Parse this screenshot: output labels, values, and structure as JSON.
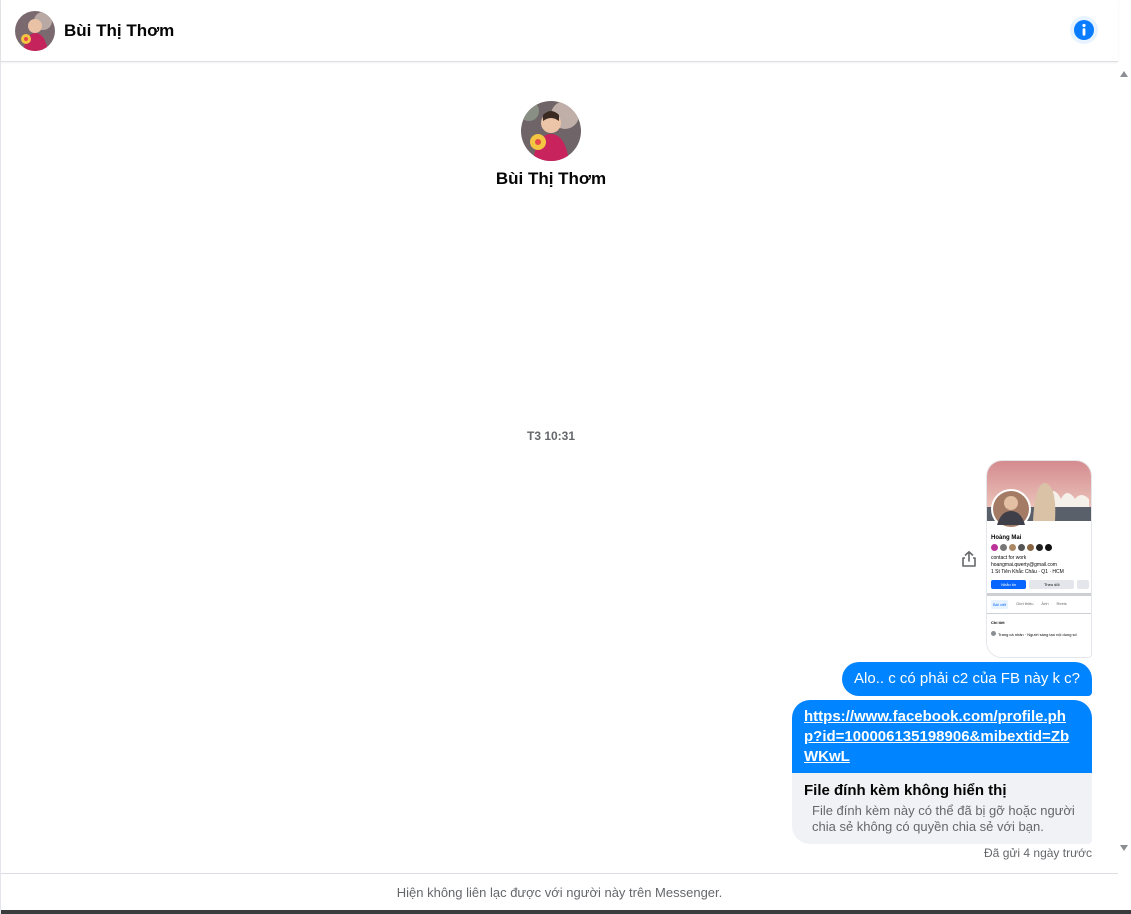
{
  "header": {
    "contact_name": "Bùi Thị Thơm",
    "info_icon": "info-icon"
  },
  "profile": {
    "name": "Bùi Thị Thơm"
  },
  "thread": {
    "timestamp": "T3 10:31",
    "shared_image": {
      "profile_name": "Hoàng Mai",
      "profile_line1": "contact for work",
      "profile_line2": "hoangmai.qwerty@gmail.com",
      "profile_line3": "1 St Tiên Khắc Châu · Q1 · HCM",
      "button_primary": "Nhắn tin",
      "button_secondary": "Theo dõi",
      "tabs": [
        "Bài viết",
        "Giới thiệu",
        "Ảnh",
        "Reels"
      ],
      "section": "Chi tiết",
      "detail": "Trang cá nhân · Người sáng tạo nội dung số"
    },
    "messages": [
      {
        "text": "Alo.. c có phải c2 của FB này k c?"
      },
      {
        "link": "https://www.facebook.com/profile.php?id=100006135198906&mibextid=ZbWKwL"
      }
    ],
    "attachment": {
      "title": "File đính kèm không hiển thị",
      "description": "File đính kèm này có thể đã bị gỡ hoặc người chia sẻ không có quyền chia sẻ với bạn."
    },
    "sent_status": "Đã gửi 4 ngày trước"
  },
  "footer": {
    "notice": "Hiện không liên lạc được với người này trên Messenger."
  },
  "colors": {
    "accent": "#0084ff",
    "bubble_gray": "#f0f2f5",
    "secondary_text": "#65676b"
  }
}
